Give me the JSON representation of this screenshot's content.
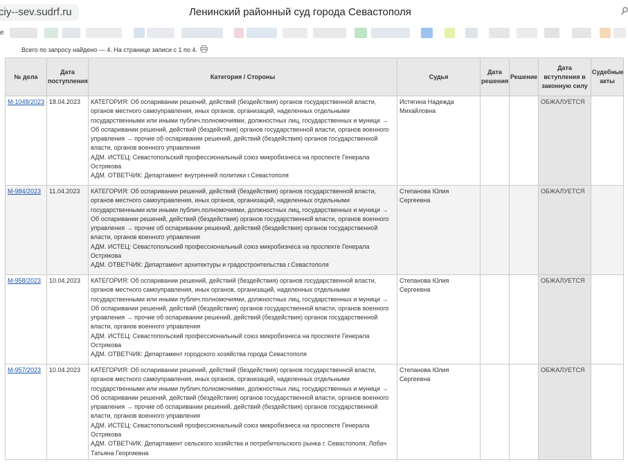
{
  "browser": {
    "url": "ciy--sev.sudrf.ru",
    "title": "Ленинский районный суд города Севастополя",
    "bookmarks_letter": "е"
  },
  "summary": "Всего по запросу найдено — 4. На странице записи с 1 по 4.",
  "table": {
    "headers": {
      "case": "№ дела",
      "received": "Дата поступления",
      "category": "Категория / Стороны",
      "judge": "Судья",
      "decision_date": "Дата решения",
      "decision": "Решение",
      "effective": "Дата вступления в законную силу",
      "acts": "Судебные акты"
    },
    "rows": [
      {
        "case": "М-1048/2023",
        "received": "18.04.2023",
        "category": "КАТЕГОРИЯ: Об оспаривании решений, действий (бездействия) органов государственной власти, органов местного самоуправления, иных органов, организаций, наделенных отдельными государственными или иными публич.полномочиями, должностных лиц, государственных и муници → Об оспаривании решений, действий (бездействия) органов государственной власти, органов военного управления → прочие об оспаривании решений, действий (бездействия) органов государственной власти, органов военного управления",
        "plaintiff": "АДМ. ИСТЕЦ: Севастопольский профессиональный союз микробизнеса на проспекте Генерала Острякова",
        "defendant": "АДМ. ОТВЕТЧИК: Департамент внутренней политики г.Севастополя",
        "judge": "Истягина Надежда Михайловна",
        "decision_date": "",
        "decision": "",
        "effective": "ОБЖАЛУЕТСЯ",
        "acts": ""
      },
      {
        "case": "М-984/2023",
        "received": "11.04.2023",
        "category": "КАТЕГОРИЯ: Об оспаривании решений, действий (бездействия) органов государственной власти, органов местного самоуправления, иных органов, организаций, наделенных отдельными государственными или иными публич.полномочиями, должностных лиц, государственных и муници → Об оспаривании решений, действий (бездействия) органов государственной власти, органов военного управления → прочие об оспаривании решений, действий (бездействия) органов государственной власти, органов военного управления",
        "plaintiff": "АДМ. ИСТЕЦ: Севастопольский профессиональный союз микробизнеса на проспекте Генерала Острякова",
        "defendant": "АДМ. ОТВЕТЧИК: Департамент архитектуры и градостроительства г.Севастополя",
        "judge": "Степанова Юлия Сергеевна",
        "decision_date": "",
        "decision": "",
        "effective": "ОБЖАЛУЕТСЯ",
        "acts": ""
      },
      {
        "case": "М-958/2023",
        "received": "10.04.2023",
        "category": "КАТЕГОРИЯ: Об оспаривании решений, действий (бездействия) органов государственной власти, органов местного самоуправления, иных органов, организаций, наделенных отдельными государственными или иными публич.полномочиями, должностных лиц, государственных и муници → Об оспаривании решений, действий (бездействия) органов государственной власти, органов военного управления → прочие об оспаривании решений, действий (бездействия) органов государственной власти, органов военного управления",
        "plaintiff": "АДМ. ИСТЕЦ: Севастопольский профессиональный союз микробизнеса на проспекте Генерала Острякова",
        "defendant": "АДМ. ОТВЕТЧИК: Департамент городского хозяйства города Севастополя",
        "judge": "Степанова Юлия Сергеевна",
        "decision_date": "",
        "decision": "",
        "effective": "ОБЖАЛУЕТСЯ",
        "acts": ""
      },
      {
        "case": "М-957/2023",
        "received": "10.04.2023",
        "category": "КАТЕГОРИЯ: Об оспаривании решений, действий (бездействия) органов государственной власти, органов местного самоуправления, иных органов, организаций, наделенных отдельными государственными или иными публич.полномочиями, должностных лиц, государственных и муници → Об оспаривании решений, действий (бездействия) органов государственной власти, органов военного управления → прочие об оспаривании решений, действий (бездействия) органов государственной власти, органов военного управления",
        "plaintiff": "АДМ. ИСТЕЦ: Севастопольский профессиональный союз микробизнеса на проспекте Генерала Острякова",
        "defendant": "АДМ. ОТВЕТЧИК: Департамент сельского хозяйства и потребительского рынка г. Севастополя, Лобач Татьяна Георгиевна",
        "judge": "Степанова Юлия Сергеевна",
        "decision_date": "",
        "decision": "",
        "effective": "ОБЖАЛУЕТСЯ",
        "acts": ""
      }
    ]
  }
}
